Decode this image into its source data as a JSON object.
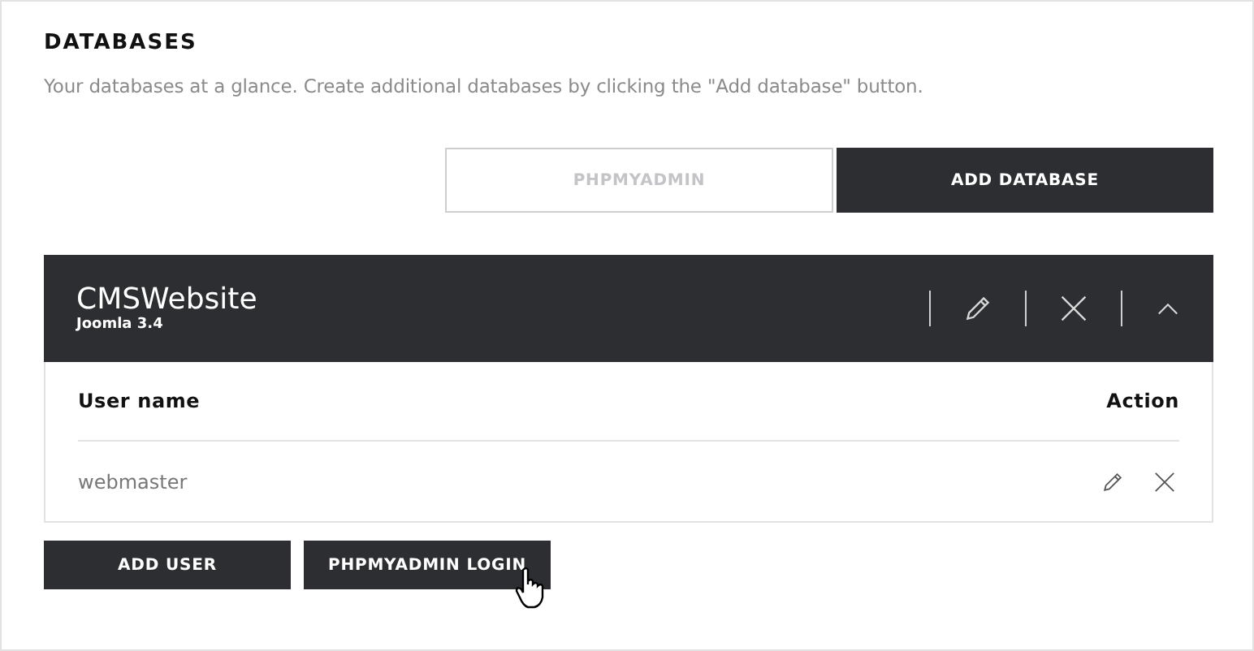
{
  "section": {
    "title": "DATABASES",
    "description": "Your databases at a glance. Create additional databases by clicking the \"Add database\" button."
  },
  "top_buttons": [
    {
      "label": "PHPMYADMIN",
      "disabled": true
    },
    {
      "label": "ADD DATABASE",
      "disabled": false
    }
  ],
  "database": {
    "name": "CMSWebsite",
    "subtitle": "Joomla 3.4",
    "expanded": true,
    "columns": [
      "User name",
      "Action"
    ],
    "users": [
      {
        "name": "webmaster"
      }
    ]
  },
  "bottom_buttons": [
    {
      "label": "ADD USER"
    },
    {
      "label": "PHPMYADMIN LOGIN"
    }
  ]
}
